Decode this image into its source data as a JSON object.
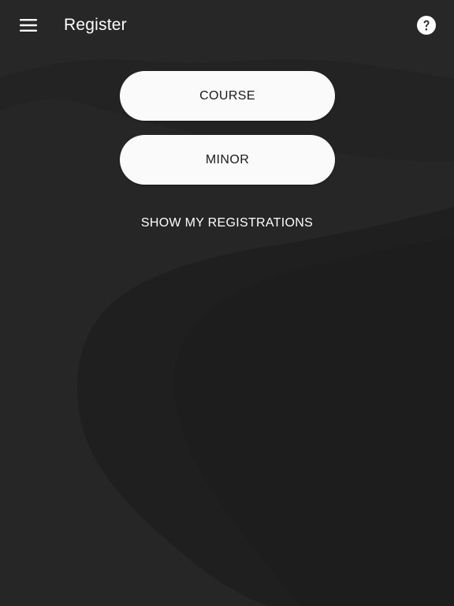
{
  "app_bar": {
    "title": "Register",
    "menu_icon": "hamburger-menu-icon",
    "help_icon": "help-circle-icon"
  },
  "actions": {
    "course_label": "COURSE",
    "minor_label": "MINOR",
    "show_registrations_label": "SHOW MY REGISTRATIONS"
  },
  "colors": {
    "background": "#262626",
    "dune_dark": "#1c1c1c",
    "pill_background": "#fafafa",
    "text_on_dark": "#ffffff",
    "text_on_pill": "#1a1a1a"
  }
}
